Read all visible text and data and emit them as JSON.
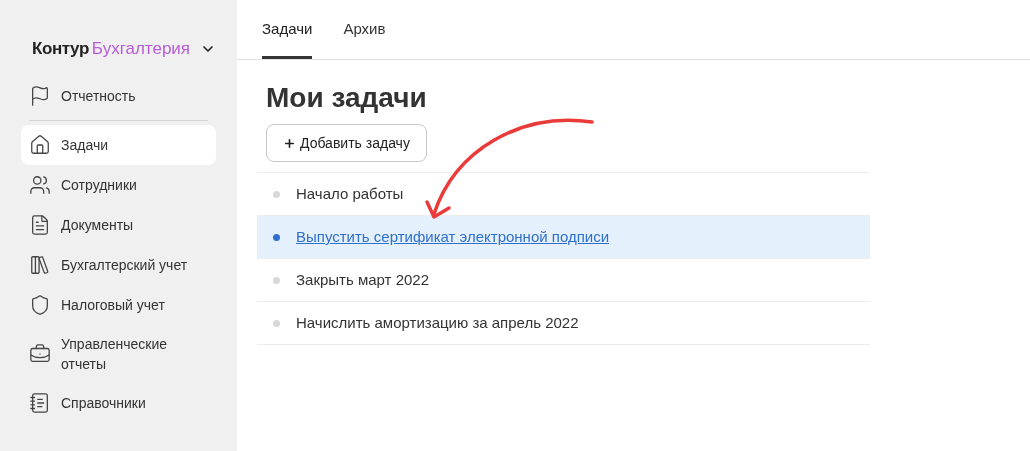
{
  "logo": {
    "brand": "Контур",
    "product": "Бухгалтерия"
  },
  "sidebar": {
    "items": [
      {
        "label": "Отчетность",
        "selected": false
      },
      {
        "label": "Задачи",
        "selected": true
      },
      {
        "label": "Сотрудники",
        "selected": false
      },
      {
        "label": "Документы",
        "selected": false
      },
      {
        "label": "Бухгалтерский учет",
        "selected": false
      },
      {
        "label": "Налоговый учет",
        "selected": false
      },
      {
        "label": "Управленческие отчеты",
        "selected": false
      },
      {
        "label": "Справочники",
        "selected": false
      }
    ]
  },
  "tabs": [
    {
      "label": "Задачи",
      "selected": true
    },
    {
      "label": "Архив",
      "selected": false
    }
  ],
  "title": "Мои задачи",
  "add_button": "Добавить задачу",
  "tasks": [
    {
      "label": "Начало работы",
      "selected": false
    },
    {
      "label": "Выпустить сертификат электронной подписи",
      "selected": true
    },
    {
      "label": "Закрыть март 2022",
      "selected": false
    },
    {
      "label": "Начислить амортизацию за апрель 2022",
      "selected": false
    }
  ]
}
